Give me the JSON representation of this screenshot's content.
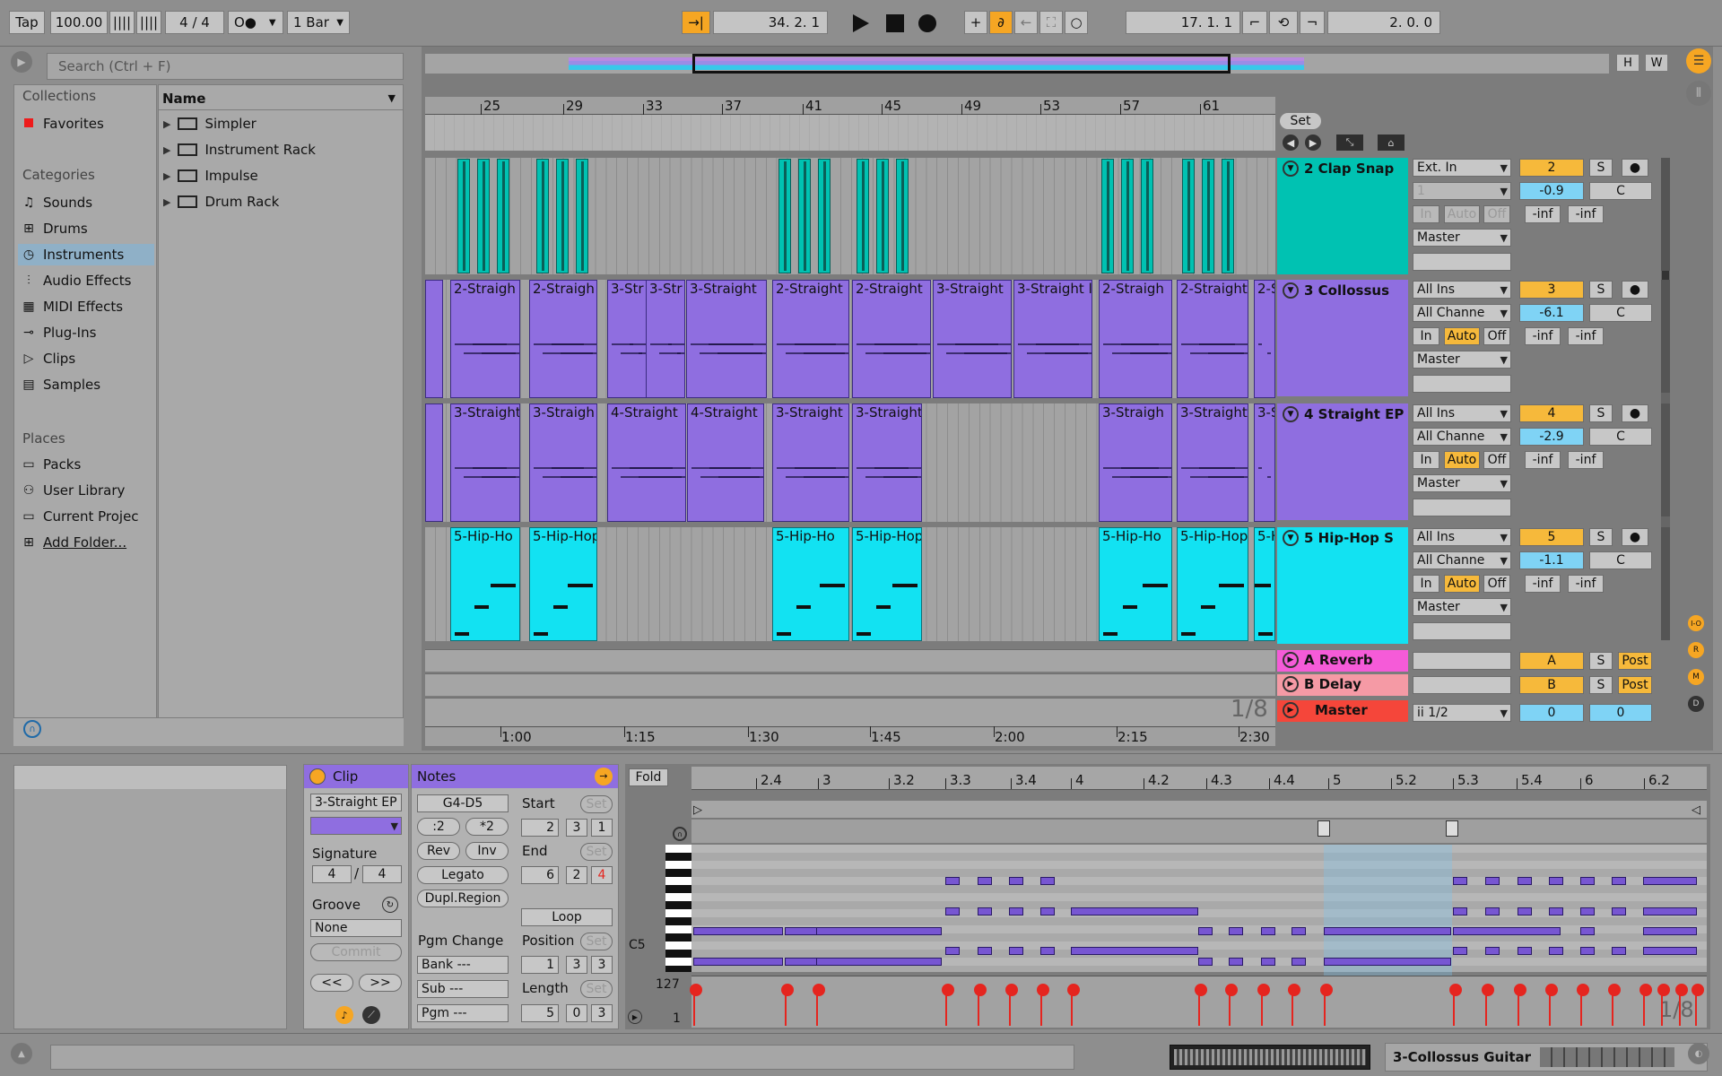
{
  "transport": {
    "tap": "Tap",
    "tempo": "100.00",
    "signature": "4 / 4",
    "quantize": "1 Bar",
    "position": "34.  2.  1",
    "loop_start": "17.  1.  1",
    "loop_length": "2.  0.  0"
  },
  "browser": {
    "search_placeholder": "Search (Ctrl + F)",
    "collections_title": "Collections",
    "favorites": "Favorites",
    "categories_title": "Categories",
    "categories": [
      "Sounds",
      "Drums",
      "Instruments",
      "Audio Effects",
      "MIDI Effects",
      "Plug-Ins",
      "Clips",
      "Samples"
    ],
    "places_title": "Places",
    "places": [
      "Packs",
      "User Library",
      "Current Projec",
      "Add Folder..."
    ],
    "name_header": "Name",
    "items": [
      "Simpler",
      "Instrument Rack",
      "Impulse",
      "Drum Rack"
    ]
  },
  "arrangement": {
    "bar_labels": [
      "25",
      "29",
      "33",
      "37",
      "41",
      "45",
      "49",
      "53",
      "57",
      "61"
    ],
    "time_labels": [
      "1:00",
      "1:15",
      "1:30",
      "1:45",
      "2:00",
      "2:15",
      "2:30"
    ],
    "grid_label": "1/8",
    "set_label": "Set",
    "overview_h": "H",
    "overview_w": "W"
  },
  "tracks": [
    {
      "name": "2 Clap Snap",
      "color": "#00c2b2",
      "input": "Ext. In",
      "channel": "1",
      "output": "Master",
      "num": "2",
      "vol": "-0.9",
      "pan": "C",
      "peak1": "-inf",
      "peak2": "-inf",
      "monitor": [
        "In",
        "Auto",
        "Off"
      ]
    },
    {
      "name": "3 Collossus",
      "color": "#8f6ee0",
      "input": "All Ins",
      "channel": "All Channe",
      "output": "Master",
      "num": "3",
      "vol": "-6.1",
      "pan": "C",
      "peak1": "-inf",
      "peak2": "-inf",
      "monitor": [
        "In",
        "Auto",
        "Off"
      ]
    },
    {
      "name": "4 Straight EP",
      "color": "#8f6ee0",
      "input": "All Ins",
      "channel": "All Channe",
      "output": "Master",
      "num": "4",
      "vol": "-2.9",
      "pan": "C",
      "peak1": "-inf",
      "peak2": "-inf",
      "monitor": [
        "In",
        "Auto",
        "Off"
      ]
    },
    {
      "name": "5 Hip-Hop S",
      "color": "#12e2f2",
      "input": "All Ins",
      "channel": "All Channe",
      "output": "Master",
      "num": "5",
      "vol": "-1.1",
      "pan": "C",
      "peak1": "-inf",
      "peak2": "-inf",
      "monitor": [
        "In",
        "Auto",
        "Off"
      ]
    }
  ],
  "returns": [
    {
      "name": "A Reverb",
      "color": "#f55bd8",
      "letter": "A",
      "post": "Post"
    },
    {
      "name": "B Delay",
      "color": "#f59aa5",
      "letter": "B",
      "post": "Post"
    }
  ],
  "master": {
    "name": "Master",
    "color": "#f5463a",
    "output": "ii 1/2",
    "vol1": "0",
    "vol2": "0"
  },
  "clip_labels": {
    "t2": [
      "2-Straigh",
      "2-Straigh",
      "3-Str",
      "3-Str",
      "3-Straight",
      "2-Straight",
      "2-Straight",
      "3-Straight",
      "3-Straight l",
      "2-Straigh",
      "2-Straight",
      "2-S"
    ],
    "t3": [
      "3-Straight",
      "3-Straigh",
      "4-Straight",
      "4-Straight",
      "3-Straight",
      "3-Straight",
      "3-Straigh",
      "3-Straight",
      "3-S"
    ],
    "t4": [
      "5-Hip-Ho",
      "5-Hip-Hop",
      "5-Hip-Ho",
      "5-Hip-Hop",
      "5-Hip-Ho",
      "5-Hip-Hop",
      "5-H"
    ]
  },
  "clip_panel": {
    "title": "Clip",
    "clip_name": "3-Straight EP",
    "signature_label": "Signature",
    "sig_num": "4",
    "sig_den": "4",
    "groove_label": "Groove",
    "groove_value": "None",
    "commit": "Commit",
    "prev": "<<",
    "next": ">>"
  },
  "notes_panel": {
    "title": "Notes",
    "range": "G4-D5",
    "div2": ":2",
    "mul2": "*2",
    "rev": "Rev",
    "inv": "Inv",
    "legato": "Legato",
    "dupl": "Dupl.Region",
    "start_label": "Start",
    "end_label": "End",
    "set": "Set",
    "start": [
      "2",
      "3",
      "1"
    ],
    "end": [
      "6",
      "2",
      "4"
    ],
    "loop": "Loop",
    "position_label": "Position",
    "position": [
      "1",
      "3",
      "3"
    ],
    "length_label": "Length",
    "length": [
      "5",
      "0",
      "3"
    ],
    "pgm_change": "Pgm Change",
    "bank": "Bank ---",
    "sub": "Sub ---",
    "pgm": "Pgm ---"
  },
  "editor": {
    "fold": "Fold",
    "ruler": [
      "2.4",
      "3",
      "3.2",
      "3.3",
      "3.4",
      "4",
      "4.2",
      "4.3",
      "4.4",
      "5",
      "5.2",
      "5.3",
      "5.4",
      "6",
      "6.2"
    ],
    "c5": "C5",
    "vel_max": "127",
    "vel_min": "1",
    "grid_label": "1/8"
  },
  "status": {
    "clip_name": "3-Collossus Guitar"
  }
}
